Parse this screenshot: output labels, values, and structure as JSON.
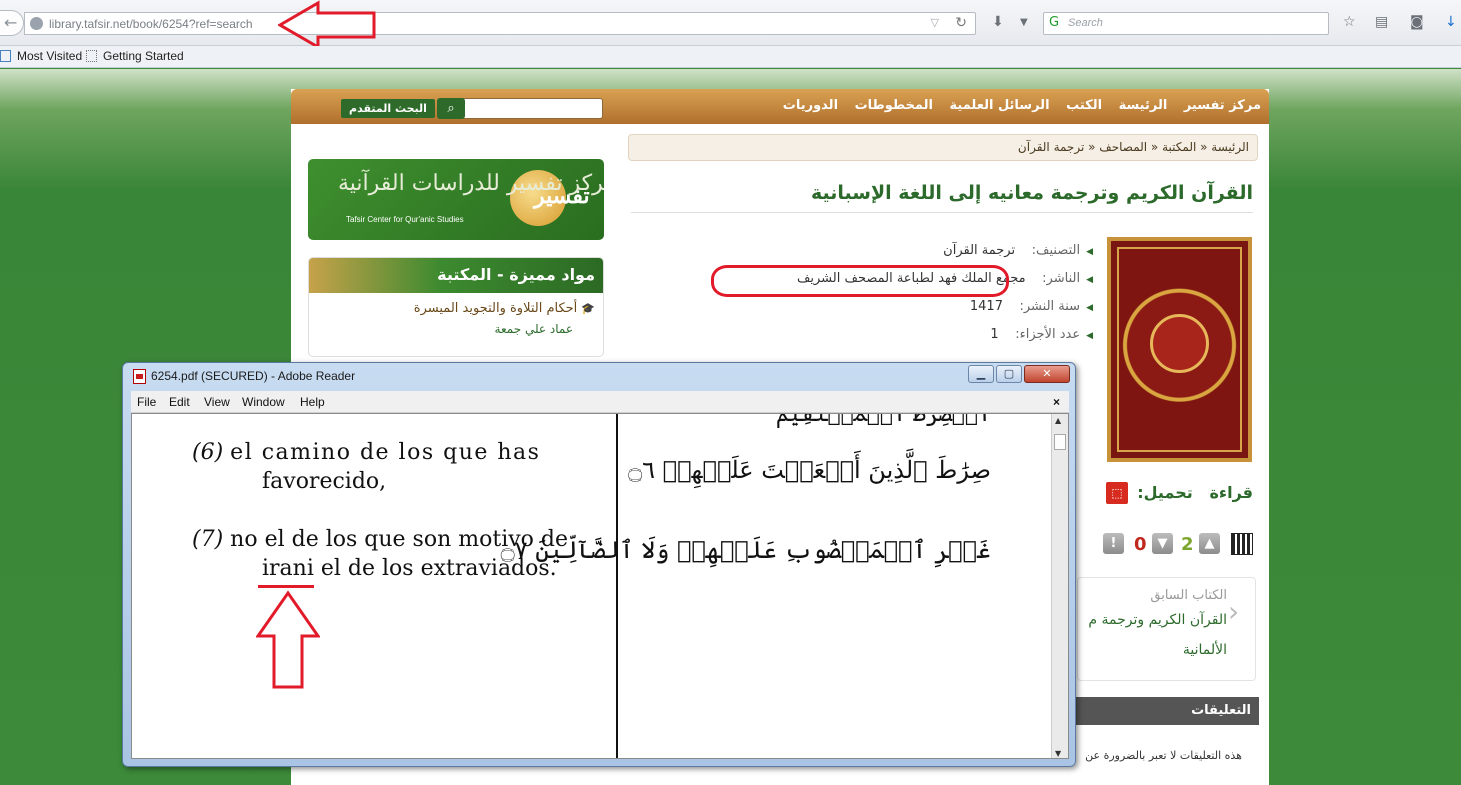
{
  "browser": {
    "url": "library.tafsir.net/book/6254?ref=search",
    "search_placeholder": "Search",
    "bookmarks": [
      "Most Visited",
      "Getting Started"
    ]
  },
  "site": {
    "nav": [
      "مركز تفسير",
      "الرئيسة",
      "الكتب",
      "الرسائل العلمية",
      "المخطوطات",
      "الدوريات"
    ],
    "advanced_search": "البحث المتقدم",
    "breadcrumb": "الرئيسة « المكتبة « المصاحف « ترجمة القرآن",
    "title": "القرآن الكريم وترجمة معانيه إلى اللغة الإسبانية",
    "meta": {
      "category_key": "التصنيف:",
      "category_val": "ترجمة القرآن",
      "publisher_key": "الناشر:",
      "publisher_val": "مجمع الملك فهد لطباعة المصحف الشريف",
      "year_key": "سنة النشر:",
      "year_val": "1417",
      "parts_key": "عدد الأجزاء:",
      "parts_val": "1"
    },
    "read_label": "قراءة",
    "download_label": "تحميل:",
    "likes": "2",
    "dislikes": "0",
    "prev_label": "الكتاب السابق",
    "prev_title_1": "القرآن الكريم وترجمة م",
    "prev_title_2": "الألمانية",
    "comments_label": "التعليقات",
    "comments_note": "هذه التعليقات لا تعبر بالضرورة عن",
    "logo_text": "مركز تفسير للدراسات القرآنية",
    "logo_en": "Tafsir Center for Qur'anic Studies",
    "logo_mark": "تفسير",
    "featured_title": "مواد مميزة - المكتبة",
    "featured_item_title": "أحكام التلاوة والتجويد الميسرة",
    "featured_item_author": "عماد علي جمعة"
  },
  "reader": {
    "title": "6254.pdf (SECURED) - Adobe Reader",
    "menu": [
      "File",
      "Edit",
      "View",
      "Window",
      "Help"
    ],
    "verse6_num": "(6)",
    "verse6_line1": "el camino de los que has",
    "verse6_line2": "favorecido,",
    "verse7_num": "(7)",
    "verse7_line1": "no el de los que son motivo de",
    "verse7_line2": "irani el de los extraviados.",
    "arabic_top": "ٱلۡصِّرَٰطَ ٱلۡمُسۡتَقِيمَ",
    "arabic_verse6": "صِرَٰطَ ٱلَّذِينَ أَنۡعَمۡتَ عَلَيۡهِمۡ ۝٦",
    "arabic_verse7": "غَيۡرِ ٱلۡمَغۡضُوبِ عَلَيۡهِمۡ وَلَا ٱلضَّآلِّينَ ۝٧"
  },
  "colors": {
    "site_green": "#2c6a2b",
    "nav_orange": "#c4883e",
    "annotation_red": "#e11b2a"
  }
}
